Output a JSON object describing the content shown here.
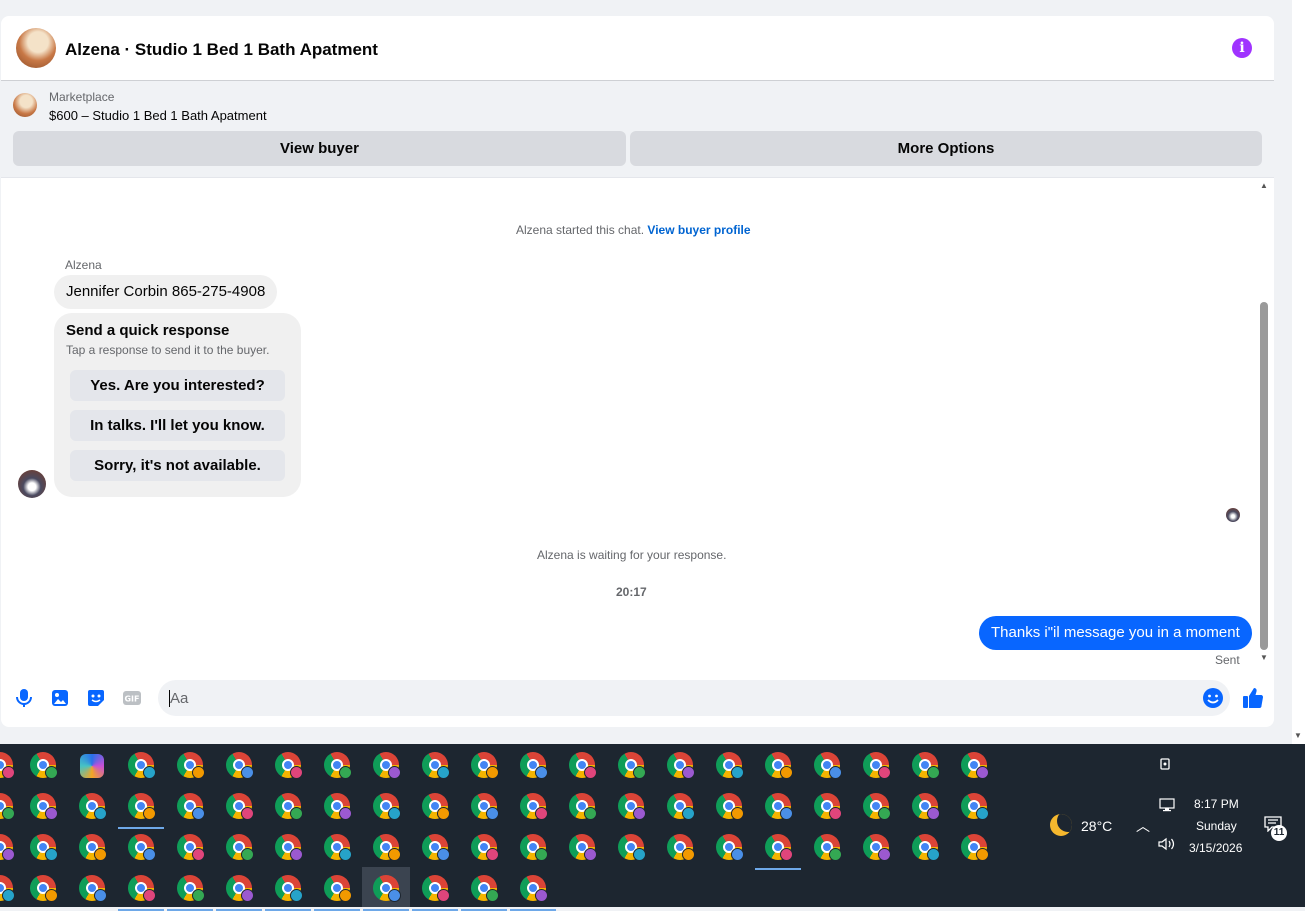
{
  "chat": {
    "title": "Alzena · Studio 1 Bed 1 Bath Apatment"
  },
  "listing": {
    "source": "Marketplace",
    "price_title": "$600 – Studio 1 Bed 1 Bath Apatment",
    "view_buyer_label": "View buyer",
    "more_options_label": "More Options"
  },
  "messages": {
    "started_text": "Alzena started this chat.",
    "view_profile_link": "View buyer profile",
    "sender_name": "Alzena",
    "incoming_text": "Jennifer Corbin 865-275-4908",
    "quick_response": {
      "title": "Send a quick response",
      "subtitle": "Tap a response to send it to the buyer.",
      "options": [
        "Yes. Are you interested?",
        "In talks. I'll let you know.",
        "Sorry, it's not available."
      ]
    },
    "waiting_text": "Alzena is waiting for your response.",
    "timestamp": "20:17",
    "outgoing_text": "Thanks i\"il message you in a moment",
    "sent_status": "Sent"
  },
  "composer": {
    "placeholder": "Aa",
    "icons": [
      "microphone-icon",
      "photo-icon",
      "sticker-icon",
      "gif-icon",
      "emoji-icon",
      "thumbs-up-icon"
    ],
    "gif_label": "GIF"
  },
  "colors": {
    "accent_blue": "#0866ff",
    "info_purple": "#a033ff",
    "link_blue": "#0064d1",
    "taskbar_bg": "#1d2630"
  },
  "taskbar": {
    "weather": {
      "icon": "moon-icon",
      "temperature": "28°C"
    },
    "clock": {
      "time": "8:17 PM",
      "day": "Sunday",
      "date": "3/15/2026"
    },
    "notification_count": "11",
    "app_icon": "chrome-profile-icon"
  }
}
